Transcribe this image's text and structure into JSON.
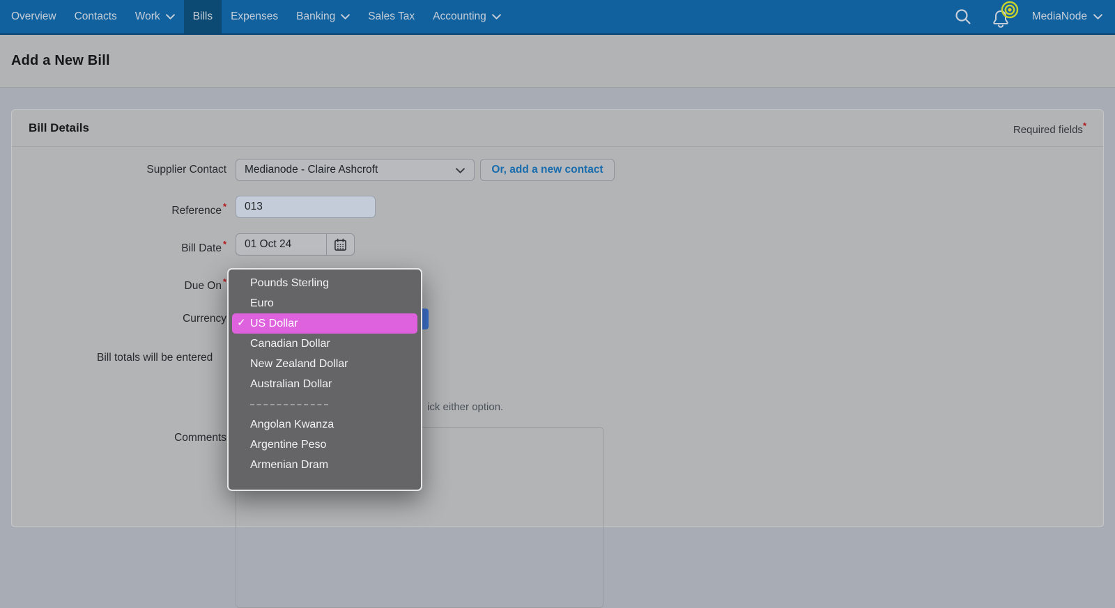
{
  "nav": {
    "items": [
      {
        "label": "Overview",
        "dropdown": false,
        "active": false
      },
      {
        "label": "Contacts",
        "dropdown": false,
        "active": false
      },
      {
        "label": "Work",
        "dropdown": true,
        "active": false
      },
      {
        "label": "Bills",
        "dropdown": false,
        "active": true
      },
      {
        "label": "Expenses",
        "dropdown": false,
        "active": false
      },
      {
        "label": "Banking",
        "dropdown": true,
        "active": false
      },
      {
        "label": "Sales Tax",
        "dropdown": false,
        "active": false
      },
      {
        "label": "Accounting",
        "dropdown": true,
        "active": false
      }
    ],
    "icons": [
      "search-icon",
      "notification-bell-icon"
    ],
    "account": {
      "label": "MediaNode",
      "dropdown": true
    }
  },
  "page": {
    "title": "Add a New Bill"
  },
  "required_marker": "*",
  "bill_details": {
    "title": "Bill Details",
    "required_note": "Required fields",
    "rows": {
      "supplier_contact": {
        "label": "Supplier Contact",
        "value": "Medianode - Claire Ashcroft",
        "add_contact_button": "Or, add a new contact"
      },
      "reference": {
        "label": "Reference",
        "required": true,
        "value": "013"
      },
      "bill_date": {
        "label": "Bill Date",
        "required": true,
        "value": "01 Oct 24"
      },
      "due_on": {
        "label": "Due On",
        "required": true
      },
      "currency": {
        "label": "Currency",
        "selected_value": "US Dollar"
      },
      "comments": {
        "label": "Comments",
        "value": ""
      }
    },
    "helper_text_fragment_left": "Bill totals will be entered",
    "helper_text_fragment_right": "ick either option."
  },
  "currency_dropdown": {
    "open": true,
    "checkmark": "✓",
    "items": [
      {
        "label": "Pounds Sterling"
      },
      {
        "label": "Euro"
      },
      {
        "label": "US Dollar",
        "selected": true
      },
      {
        "label": "Canadian Dollar"
      },
      {
        "label": "New Zealand Dollar"
      },
      {
        "label": "Australian Dollar"
      },
      {
        "type": "separator"
      },
      {
        "label": "Angolan Kwanza"
      },
      {
        "label": "Argentine Peso"
      },
      {
        "label": "Armenian Dram"
      }
    ]
  },
  "colors": {
    "navbar_blue": "#11619e",
    "navbar_active_blue": "#0d4a73",
    "selection_pink": "#de62de",
    "focus_blue": "#3e73d3",
    "required_red": "#b3161b"
  }
}
